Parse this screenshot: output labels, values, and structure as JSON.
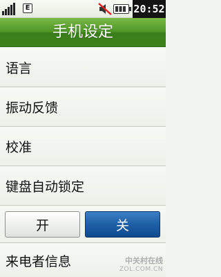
{
  "status_bar": {
    "network_type": "E",
    "time": "20:52",
    "icons": [
      "signal-strength-icon",
      "network-type-icon",
      "mute-icon",
      "battery-icon"
    ]
  },
  "title": "手机设定",
  "menu": {
    "items": [
      {
        "label": "语言"
      },
      {
        "label": "振动反馈"
      },
      {
        "label": "校准"
      },
      {
        "label": "键盘自动锁定"
      }
    ]
  },
  "toggle": {
    "on_label": "开",
    "off_label": "关",
    "selected": "关"
  },
  "next_item": {
    "label": "来电者信息"
  },
  "watermark": {
    "cn": "中关村在线",
    "en": "ZOL.COM.CN"
  },
  "colors": {
    "title_green": "#4f9627",
    "selected_blue": "#1d5fa6",
    "clock_bg": "#141414"
  }
}
